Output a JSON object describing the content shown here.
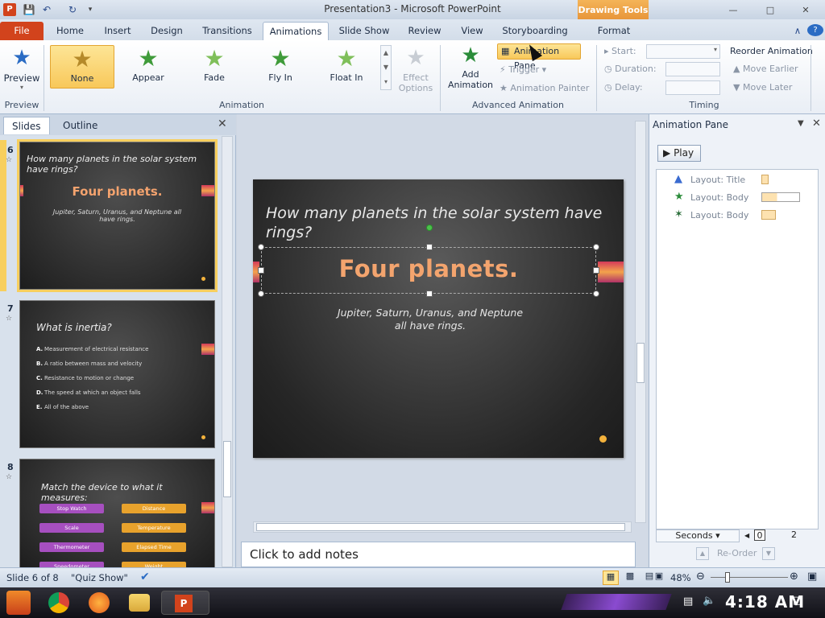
{
  "app": {
    "title": "Presentation3 - Microsoft PowerPoint",
    "context_tab": "Drawing Tools"
  },
  "tabs": [
    "File",
    "Home",
    "Insert",
    "Design",
    "Transitions",
    "Animations",
    "Slide Show",
    "Review",
    "View",
    "Storyboarding",
    "Format"
  ],
  "ribbon": {
    "preview": {
      "label": "Preview",
      "group": "Preview"
    },
    "animation_gallery": [
      {
        "label": "None",
        "color": "#c9a13a"
      },
      {
        "label": "Appear",
        "color": "#3f9b3a"
      },
      {
        "label": "Fade",
        "color": "#7fbf5a"
      },
      {
        "label": "Fly In",
        "color": "#3f9b3a"
      },
      {
        "label": "Float In",
        "color": "#7fbf5a"
      }
    ],
    "effect_options": {
      "line1": "Effect",
      "line2": "Options"
    },
    "animation_group": "Animation",
    "add_animation": {
      "line1": "Add",
      "line2": "Animation"
    },
    "animation_pane_btn": "Animation Pane",
    "trigger_btn": "Trigger",
    "animation_painter_btn": "Animation Painter",
    "advanced_group": "Advanced Animation",
    "start_label": "Start:",
    "duration_label": "Duration:",
    "delay_label": "Delay:",
    "timing_group": "Timing",
    "reorder_title": "Reorder Animation",
    "move_earlier": "Move Earlier",
    "move_later": "Move Later"
  },
  "left_panel": {
    "tabs": [
      "Slides",
      "Outline"
    ],
    "slides": [
      {
        "num": "6",
        "title": "How many planets in the solar system have rings?",
        "big": "Four planets.",
        "sub": "Jupiter, Saturn, Uranus, and Neptune all have rings."
      },
      {
        "num": "7",
        "title": "What is inertia?",
        "options": [
          {
            "key": "A.",
            "text": "Measurement of electrical resistance"
          },
          {
            "key": "B.",
            "text": "A ratio between mass and velocity"
          },
          {
            "key": "C.",
            "text": "Resistance to motion or change"
          },
          {
            "key": "D.",
            "text": "The speed at which an object falls"
          },
          {
            "key": "E.",
            "text": "All of the above"
          }
        ]
      },
      {
        "num": "8",
        "title": "Match the device to what it measures:",
        "left_items": [
          "Stop Watch",
          "Scale",
          "Thermometer",
          "Speedometer"
        ],
        "right_items": [
          "Distance",
          "Temperature",
          "Elapsed Time",
          "Weight"
        ]
      }
    ]
  },
  "slide": {
    "title": "How many planets in the solar system have rings?",
    "answer": "Four planets.",
    "detail": "Jupiter, Saturn, Uranus, and Neptune all have rings."
  },
  "notes": {
    "placeholder": "Click to add notes"
  },
  "animation_pane": {
    "title": "Animation Pane",
    "play": "Play",
    "items": [
      "Layout: Title",
      "Layout: Body",
      "Layout: Body"
    ],
    "seconds": "Seconds",
    "timeline_start": "0",
    "timeline_next": "2",
    "reorder": "Re-Order"
  },
  "status": {
    "slide": "Slide 6 of 8",
    "theme": "\"Quiz Show\"",
    "zoom": "48%"
  },
  "taskbar": {
    "time": "4:18 AM"
  }
}
